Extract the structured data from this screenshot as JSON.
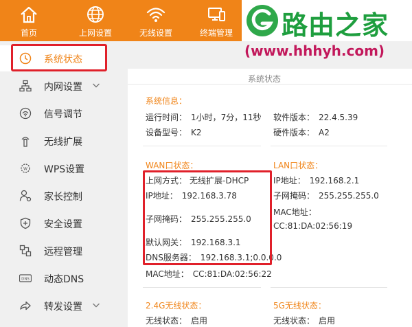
{
  "nav": [
    {
      "label": "首页",
      "icon": "home-icon"
    },
    {
      "label": "上网设置",
      "icon": "globe-icon"
    },
    {
      "label": "无线设置",
      "icon": "wifi-icon"
    },
    {
      "label": "终端管理",
      "icon": "devices-icon"
    }
  ],
  "watermark": {
    "text": "路由之家",
    "url": "(www.hhhyh.com)"
  },
  "sidebar": {
    "items": [
      {
        "label": "系统状态",
        "icon": "clock-icon",
        "active": true
      },
      {
        "label": "内网设置",
        "icon": "network-icon",
        "expandable": true
      },
      {
        "label": "信号调节",
        "icon": "signal-icon"
      },
      {
        "label": "无线扩展",
        "icon": "wireless-extend-icon"
      },
      {
        "label": "WPS设置",
        "icon": "wps-icon"
      },
      {
        "label": "家长控制",
        "icon": "parental-icon"
      },
      {
        "label": "安全设置",
        "icon": "shield-icon"
      },
      {
        "label": "远程管理",
        "icon": "remote-icon"
      },
      {
        "label": "动态DNS",
        "icon": "dns-icon"
      },
      {
        "label": "转发设置",
        "icon": "forward-icon",
        "expandable": true
      }
    ]
  },
  "main": {
    "page_title": "系统状态",
    "system": {
      "title": "系统信息：",
      "uptime_label": "运行时间：",
      "uptime_value": "1小时，7分，11秒",
      "model_label": "设备型号：",
      "model_value": "K2",
      "sw_label": "软件版本：",
      "sw_value": "22.4.5.39",
      "hw_label": "硬件版本：",
      "hw_value": "A2"
    },
    "wan": {
      "title": "WAN口状态：",
      "mode_label": "上网方式：",
      "mode_value": "无线扩展-DHCP",
      "ip_label": "IP地址：",
      "ip_value": "192.168.3.78",
      "mask_label": "子网掩码：",
      "mask_value": "255.255.255.0",
      "gw_label": "默认网关：",
      "gw_value": "192.168.3.1",
      "dns_label": "DNS服务器：",
      "dns_value": "192.168.3.1;0.0.0.0",
      "mac_label": "MAC地址：",
      "mac_value": "CC:81:DA:02:56:22"
    },
    "lan": {
      "title": "LAN口状态：",
      "ip_label": "IP地址：",
      "ip_value": "192.168.2.1",
      "mask_label": "子网掩码：",
      "mask_value": "255.255.255.0",
      "mac_label": "MAC地址：",
      "mac_value": "CC:81:DA:02:56:19"
    },
    "wifi24": {
      "title": "2.4G无线状态：",
      "status_label": "无线状态：",
      "status_value": "启用"
    },
    "wifi5": {
      "title": "5G无线状态：",
      "status_label": "无线状态：",
      "status_value": "启用"
    }
  },
  "colors": {
    "accent": "#f08418",
    "highlight": "#e0202a",
    "watermark_green": "#1e9e3e",
    "watermark_url": "#c2185b"
  }
}
